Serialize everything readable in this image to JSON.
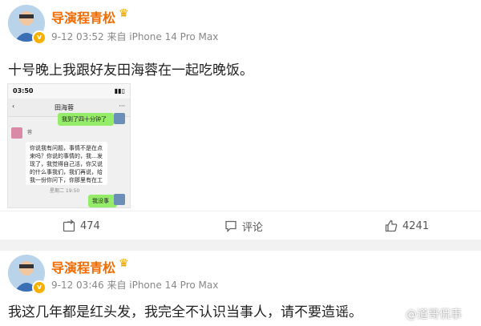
{
  "post1": {
    "username": "导演程青松",
    "meta": "9-12 03:52 来自 iPhone 14 Pro Max",
    "text": "十号晚上我跟好友田海蓉在一起吃晚饭。",
    "screenshot": {
      "status_time": "03:50",
      "chat_title": "田海蓉",
      "msg_right_1": "我到了四十分钟了",
      "msg_left_name": "蓉",
      "msg_left": "你说我有问题，事情不是在点来吗？你说的事情的，我…发现了，我觉得自己活，你又说的什么事我们，我们再说，给我一份你问下，你那里有在工作吗？",
      "msg_time": "星期二 19:50",
      "msg_right_2": "我没事"
    },
    "actions": {
      "repost": "474",
      "comment": "评论",
      "like": "4241"
    }
  },
  "post2": {
    "username": "导演程青松",
    "meta": "9-12 03:46 来自 iPhone 14 Pro Max",
    "text": "我这几年都是红头发，我完全不认识当事人，请不要造谣。"
  },
  "watermark": "@道哥侃事",
  "colors": {
    "username": "#f26b00",
    "wechat_green": "#95ec69",
    "badge": "#f6b100"
  }
}
